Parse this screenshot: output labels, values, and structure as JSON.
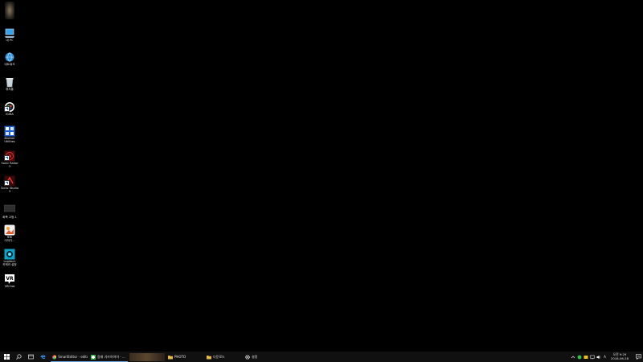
{
  "desktop": {
    "icons": [
      {
        "label": "",
        "name": "blurred-user-icon"
      },
      {
        "label": "내 PC",
        "name": "my-pc-icon"
      },
      {
        "label": "네트워크",
        "name": "network-icon"
      },
      {
        "label": "휴지통",
        "name": "recycle-bin-icon"
      },
      {
        "label": "KURA",
        "name": "kura-app-icon"
      },
      {
        "label": "Brother\nUtilities",
        "name": "brother-utilities-icon"
      },
      {
        "label": "Sonic Radar\n3",
        "name": "sonic-radar-icon"
      },
      {
        "label": "Sonic Studio\n3",
        "name": "sonic-studio-icon"
      },
      {
        "label": "화폭 고정-1",
        "name": "screen-folder-icon"
      },
      {
        "label": "포토\n이야기...",
        "name": "photo-app-icon"
      },
      {
        "label": "Logitech\n카메라 설정",
        "name": "logitech-camera-icon"
      },
      {
        "label": "VRChat",
        "name": "vrchat-icon"
      }
    ]
  },
  "taskbar": {
    "apps": [
      {
        "label": "SmartEditor - edito...",
        "name": "taskbar-chrome-smarteditor",
        "active": true
      },
      {
        "label": "장래 가즈아아아 - ...",
        "name": "taskbar-green-app",
        "active": true
      },
      {
        "label": "",
        "name": "taskbar-blurred-app",
        "active": false
      },
      {
        "label": "PHOTO",
        "name": "taskbar-folder-photo",
        "active": false
      },
      {
        "label": "다운로드",
        "name": "taskbar-folder-downloads",
        "active": false
      },
      {
        "label": "설정",
        "name": "taskbar-settings",
        "active": false
      }
    ],
    "tray_lang": "A",
    "clock_time": "오전 9:29",
    "clock_date": "2018-06-28"
  },
  "colors": {
    "desktop_bg": "#000000",
    "taskbar_bg": "#101010",
    "active_indicator": "#6fa3d9"
  }
}
